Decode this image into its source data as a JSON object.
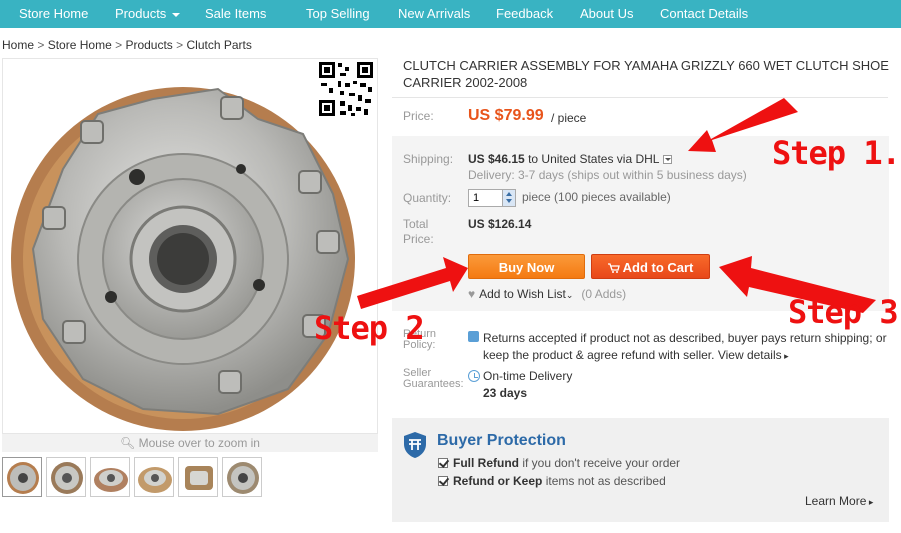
{
  "nav": {
    "items": [
      {
        "label": "Store Home"
      },
      {
        "label": "Products",
        "dropdown": true
      },
      {
        "label": "Sale Items"
      },
      {
        "label": "Top Selling"
      },
      {
        "label": "New Arrivals"
      },
      {
        "label": "Feedback"
      },
      {
        "label": "About Us"
      },
      {
        "label": "Contact Details"
      }
    ],
    "bg_color": "#39b3c2"
  },
  "breadcrumb": {
    "items": [
      "Home",
      "Store Home",
      "Products",
      "Clutch Parts"
    ],
    "separator": ">"
  },
  "gallery": {
    "zoom_hint": "Mouse over to zoom in",
    "thumbnail_count": 6
  },
  "product": {
    "title": "CLUTCH CARRIER ASSEMBLY FOR YAMAHA GRIZZLY 660 WET CLUTCH SHOE CARRIER 2002-2008",
    "price_label": "Price:",
    "price": "US $79.99",
    "price_unit": "/ piece",
    "shipping_label": "Shipping:",
    "shipping_cost": "US $46.15",
    "shipping_to": "to",
    "shipping_dest": "United States via DHL",
    "delivery": "Delivery: 3-7 days (ships out within 5 business days)",
    "quantity_label": "Quantity:",
    "quantity_value": "1",
    "quantity_note": "piece (100 pieces available)",
    "total_label": "Total Price:",
    "total": "US $126.14",
    "buy_now": "Buy Now",
    "add_to_cart": "Add to Cart",
    "wishlist": "Add to Wish List",
    "wishlist_adds": "(0 Adds)",
    "return_label": "Return Policy:",
    "return_text": "Returns accepted if product not as described, buyer pays return shipping; or keep the product & agree refund with seller.",
    "view_details": "View details",
    "guarantee_label": "Seller Guarantees:",
    "ontime": "On-time Delivery",
    "days": "23 days",
    "accent_color": "#e8541b"
  },
  "buyer_protection": {
    "title": "Buyer Protection",
    "item1_bold": "Full Refund",
    "item1_rest": "if you don't receive your order",
    "item2_bold": "Refund or Keep",
    "item2_rest": "items not as described",
    "learn_more": "Learn More"
  },
  "annotations": {
    "step1": "Step 1.",
    "step2": "Step 2",
    "step3": "Step 3.",
    "color": "#ee1111"
  }
}
